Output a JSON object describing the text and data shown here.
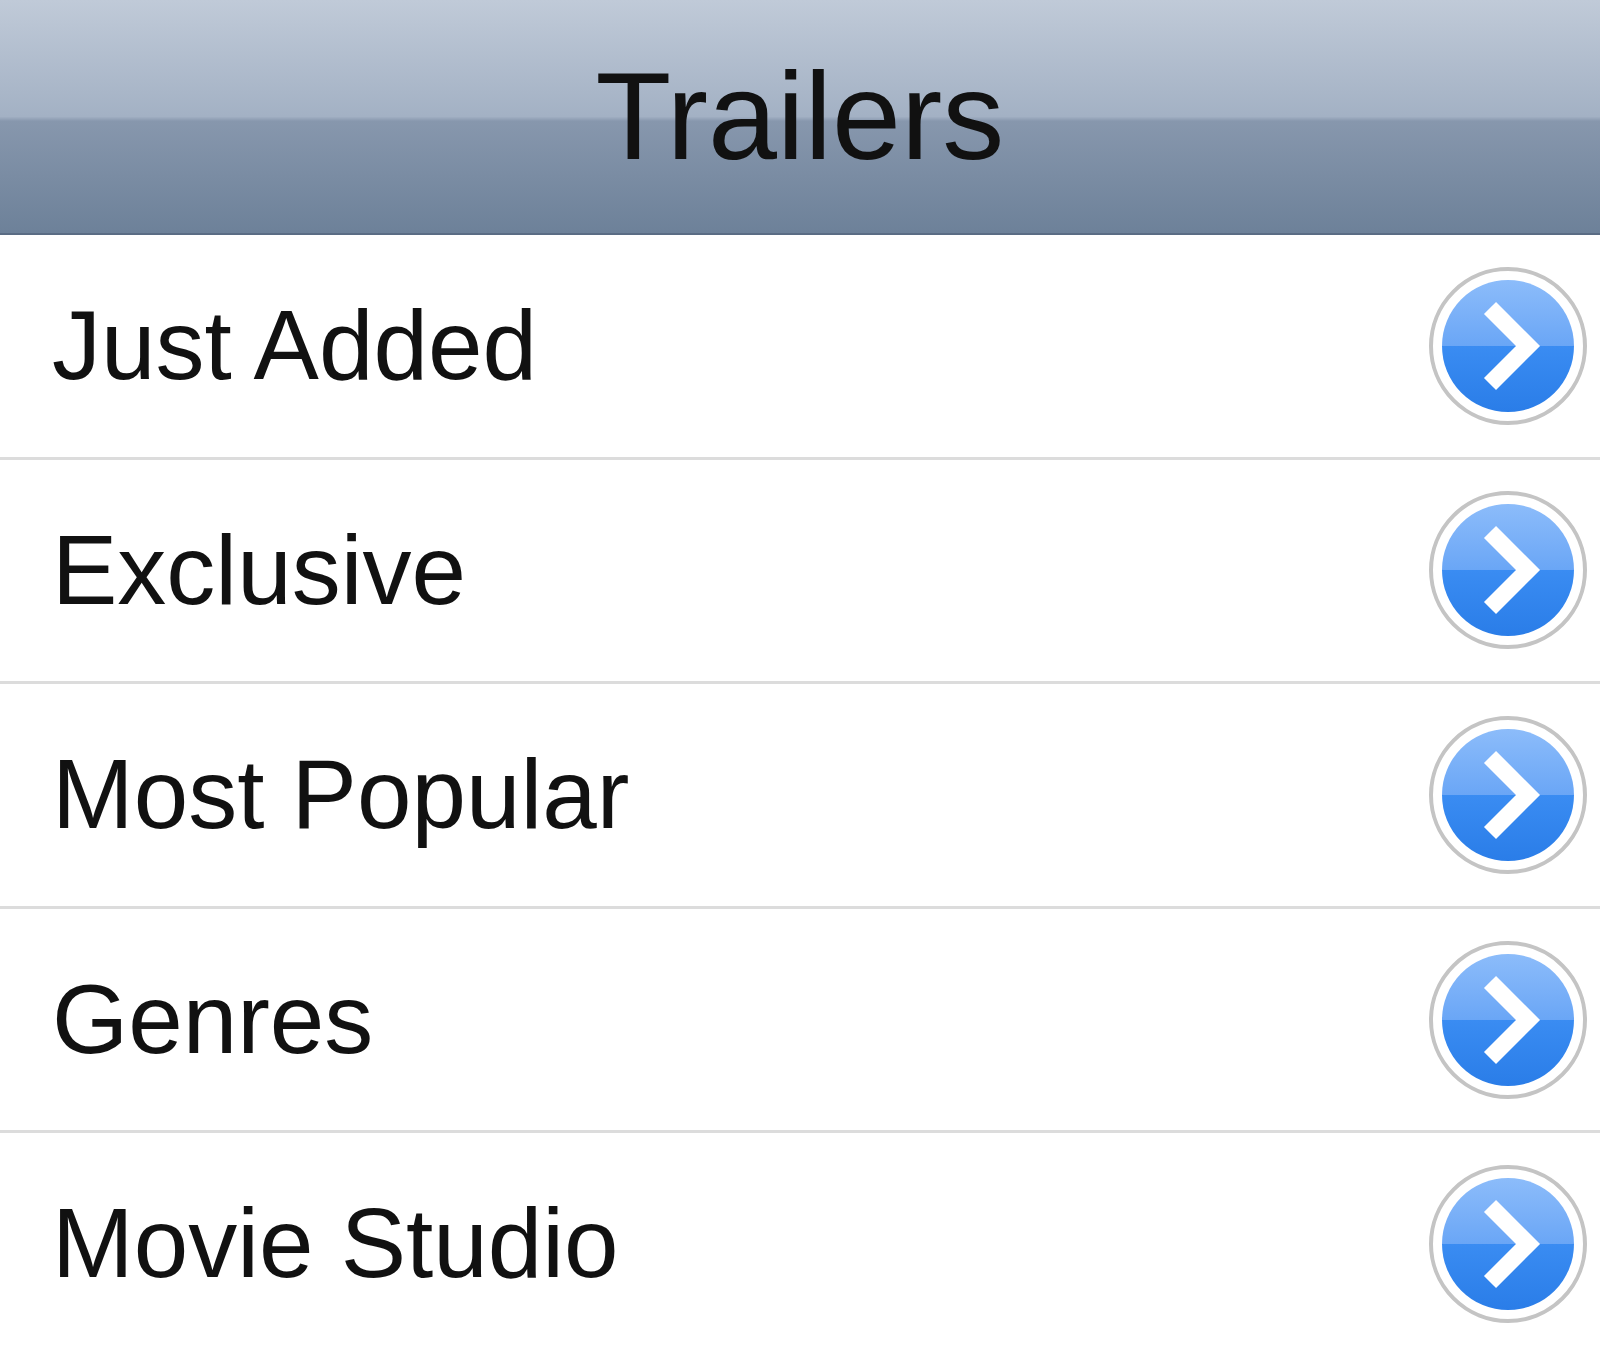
{
  "nav_bar": {
    "title": "Trailers"
  },
  "items": [
    {
      "label": "Just Added"
    },
    {
      "label": "Exclusive"
    },
    {
      "label": "Most Popular"
    },
    {
      "label": "Genres"
    },
    {
      "label": "Movie Studio"
    }
  ]
}
